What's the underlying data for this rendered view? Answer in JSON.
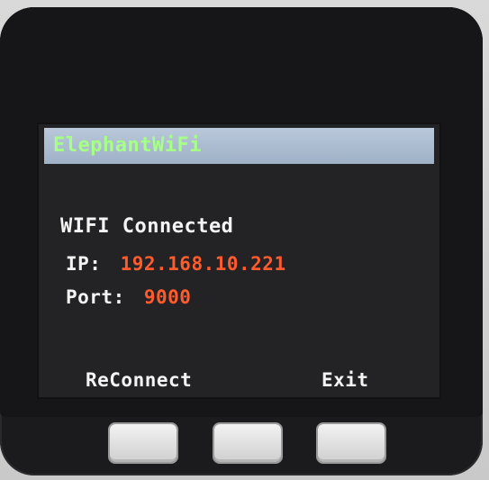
{
  "screen": {
    "title": "ElephantWiFi",
    "status_text": "WIFI Connected",
    "ip_label": "IP:",
    "ip_value": "192.168.10.221",
    "port_label": "Port:",
    "port_value": "9000"
  },
  "softkeys": {
    "left_label": "ReConnect",
    "right_label": "Exit"
  },
  "colors": {
    "title_text": "#a6ff86",
    "title_bar": "#9fb1c7",
    "value_text": "#ff5b2c",
    "label_text": "#f4f4f4",
    "screen_bg": "#232325"
  },
  "buttons": [
    "button-a",
    "button-b",
    "button-c"
  ]
}
